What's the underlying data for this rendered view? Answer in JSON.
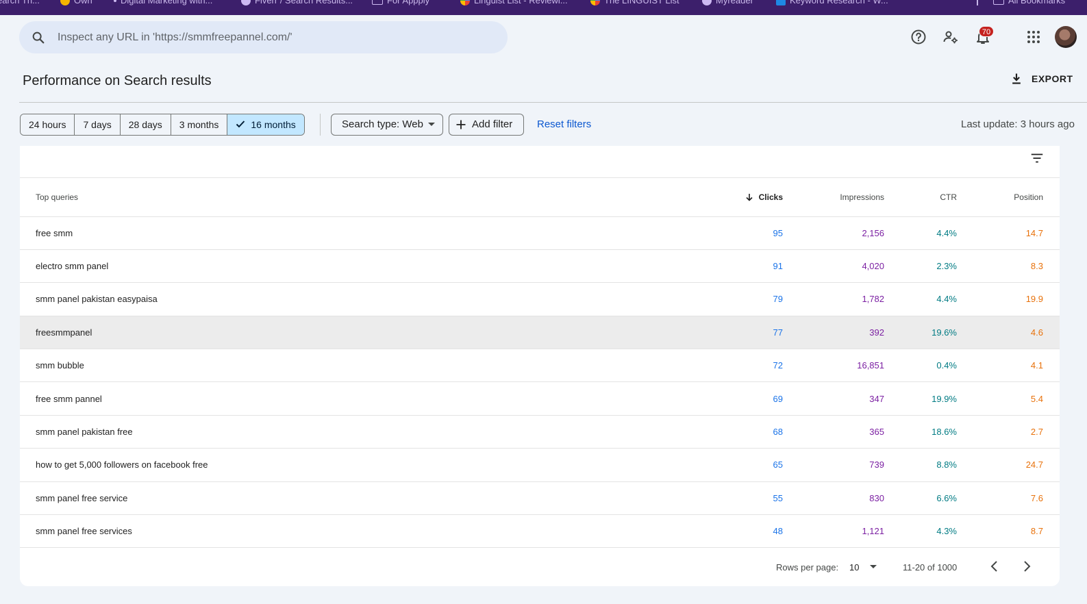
{
  "bookmarks": [
    {
      "label": "earch Th...",
      "icon": "none"
    },
    {
      "label": "Own",
      "icon": "yellow-g-icon"
    },
    {
      "label": "Digital Marketing with...",
      "icon": "dot-icon"
    },
    {
      "label": "Fiverr / Search Results...",
      "icon": "globe-icon"
    },
    {
      "label": "For Appply",
      "icon": "folder-icon"
    },
    {
      "label": "Linguist List - Reviewi...",
      "icon": "multicolor-icon"
    },
    {
      "label": "The LINGUIST List",
      "icon": "multicolor-icon"
    },
    {
      "label": "Myreader",
      "icon": "globe-icon"
    },
    {
      "label": "Keyword Research - W...",
      "icon": "keyword-icon"
    },
    {
      "label": "All Bookmarks",
      "icon": "folder-icon"
    }
  ],
  "search": {
    "placeholder": "Inspect any URL in 'https://smmfreepannel.com/'"
  },
  "notifications": {
    "count": "70"
  },
  "page": {
    "title": "Performance on Search results",
    "export_label": "EXPORT"
  },
  "filters": {
    "ranges": [
      "24 hours",
      "7 days",
      "28 days",
      "3 months",
      "16 months"
    ],
    "active_range": "16 months",
    "search_type": "Search type: Web",
    "add_filter": "Add filter",
    "reset": "Reset filters",
    "last_update": "Last update: 3 hours ago"
  },
  "table": {
    "headers": {
      "query": "Top queries",
      "clicks": "Clicks",
      "impressions": "Impressions",
      "ctr": "CTR",
      "position": "Position"
    },
    "rows": [
      {
        "query": "free smm",
        "clicks": "95",
        "impressions": "2,156",
        "ctr": "4.4%",
        "position": "14.7"
      },
      {
        "query": "electro smm panel",
        "clicks": "91",
        "impressions": "4,020",
        "ctr": "2.3%",
        "position": "8.3"
      },
      {
        "query": "smm panel pakistan easypaisa",
        "clicks": "79",
        "impressions": "1,782",
        "ctr": "4.4%",
        "position": "19.9"
      },
      {
        "query": "freesmmpanel",
        "clicks": "77",
        "impressions": "392",
        "ctr": "19.6%",
        "position": "4.6"
      },
      {
        "query": "smm bubble",
        "clicks": "72",
        "impressions": "16,851",
        "ctr": "0.4%",
        "position": "4.1"
      },
      {
        "query": "free smm pannel",
        "clicks": "69",
        "impressions": "347",
        "ctr": "19.9%",
        "position": "5.4"
      },
      {
        "query": "smm panel pakistan free",
        "clicks": "68",
        "impressions": "365",
        "ctr": "18.6%",
        "position": "2.7"
      },
      {
        "query": "how to get 5,000 followers on facebook free",
        "clicks": "65",
        "impressions": "739",
        "ctr": "8.8%",
        "position": "24.7"
      },
      {
        "query": "smm panel free service",
        "clicks": "55",
        "impressions": "830",
        "ctr": "6.6%",
        "position": "7.6"
      },
      {
        "query": "smm panel free services",
        "clicks": "48",
        "impressions": "1,121",
        "ctr": "4.3%",
        "position": "8.7"
      }
    ],
    "highlighted_row": 3
  },
  "pagination": {
    "rows_per_page_label": "Rows per page:",
    "rows_per_page": "10",
    "range": "11-20 of 1000"
  },
  "colors": {
    "clicks": "#1a73e8",
    "impressions": "#7b1fa2",
    "ctr": "#007b83",
    "position": "#e8710a",
    "accent": "#0b57d0",
    "active_chip": "#c2e7ff"
  }
}
